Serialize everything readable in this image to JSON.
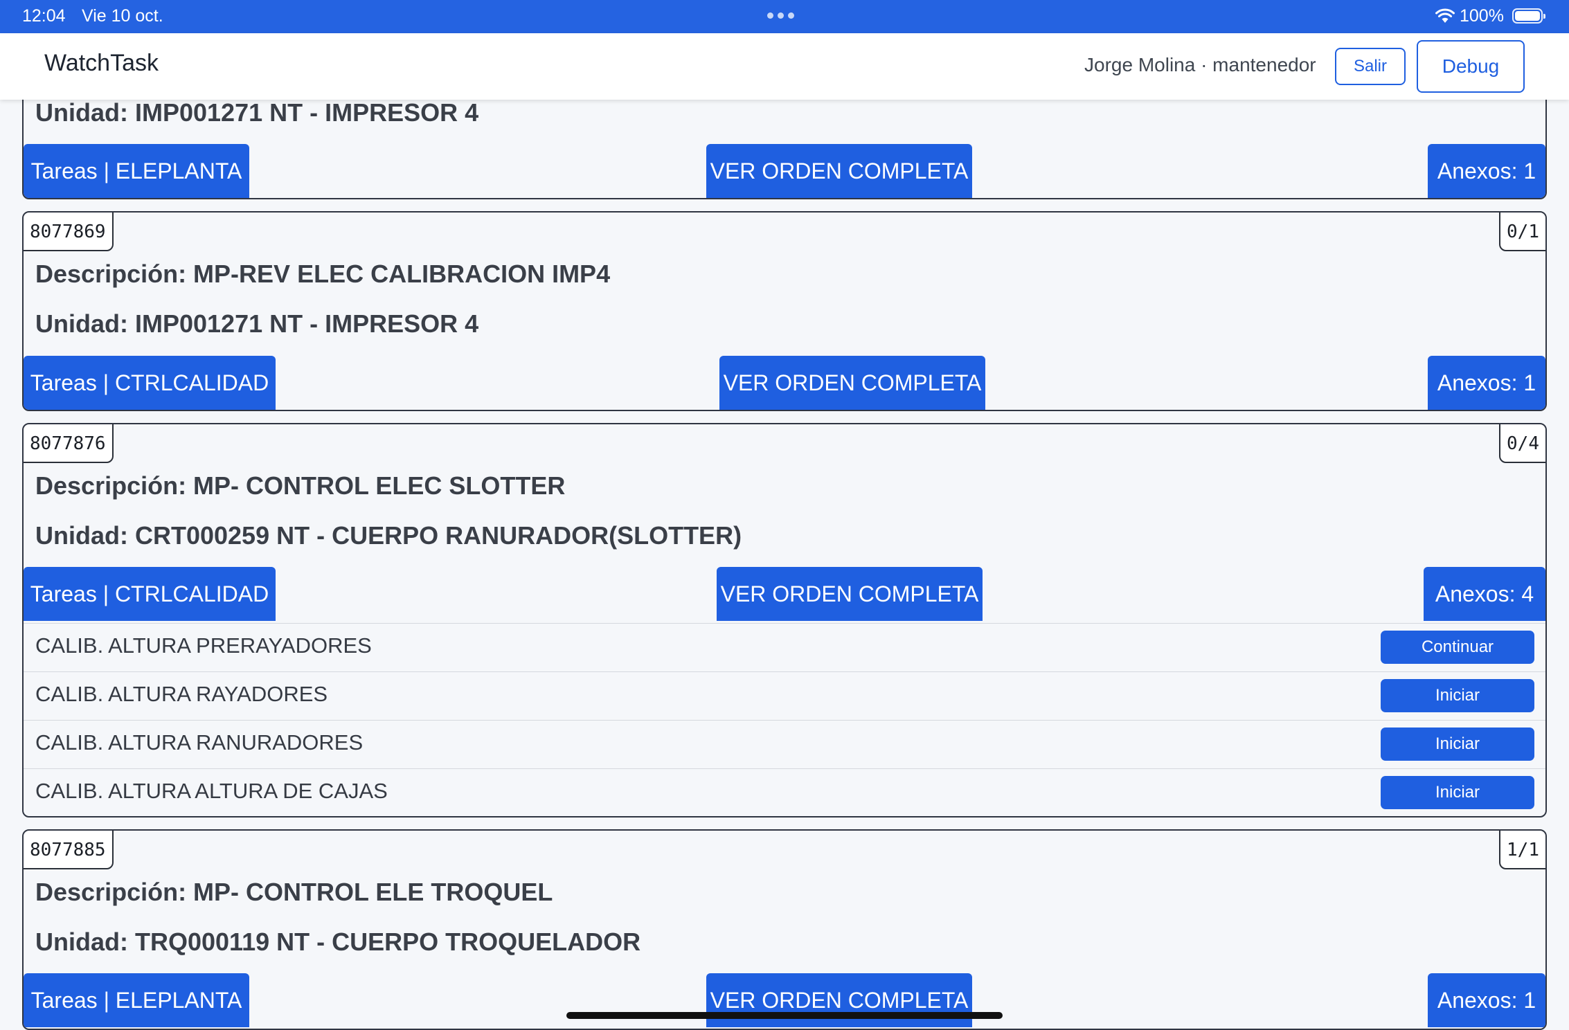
{
  "status_bar": {
    "time": "12:04",
    "date": "Vie 10 oct.",
    "battery_percent": "100%",
    "battery_level": 1.0
  },
  "header": {
    "app_title": "WatchTask",
    "user_label": "Jorge Molina · mantenedor",
    "logout_label": "Salir",
    "debug_label": "Debug"
  },
  "labels": {
    "view_order": "VER ORDEN COMPLETA"
  },
  "orders": [
    {
      "unit": "Unidad: IMP001271 NT - IMPRESOR 4",
      "tasks_tab": "Tareas | ELEPLANTA",
      "annexes": "Anexos: 1"
    },
    {
      "id": "8077869",
      "count": "0/1",
      "description": "Descripción: MP-REV ELEC CALIBRACION IMP4",
      "unit": "Unidad: IMP001271 NT - IMPRESOR 4",
      "tasks_tab": "Tareas | CTRLCALIDAD",
      "annexes": "Anexos: 1"
    },
    {
      "id": "8077876",
      "count": "0/4",
      "description": "Descripción: MP- CONTROL ELEC SLOTTER",
      "unit": "Unidad: CRT000259 NT - CUERPO RANURADOR(SLOTTER)",
      "tasks_tab": "Tareas | CTRLCALIDAD",
      "annexes": "Anexos: 4",
      "tasks": [
        {
          "name": "CALIB. ALTURA PRERAYADORES",
          "action": "Continuar"
        },
        {
          "name": "CALIB. ALTURA RAYADORES",
          "action": "Iniciar"
        },
        {
          "name": "CALIB. ALTURA RANURADORES",
          "action": "Iniciar"
        },
        {
          "name": "CALIB. ALTURA ALTURA DE CAJAS",
          "action": "Iniciar"
        }
      ]
    },
    {
      "id": "8077885",
      "count": "1/1",
      "description": "Descripción: MP- CONTROL ELE TROQUEL",
      "unit": "Unidad: TRQ000119 NT - CUERPO TROQUELADOR",
      "tasks_tab": "Tareas | ELEPLANTA",
      "annexes": "Anexos: 1"
    }
  ]
}
